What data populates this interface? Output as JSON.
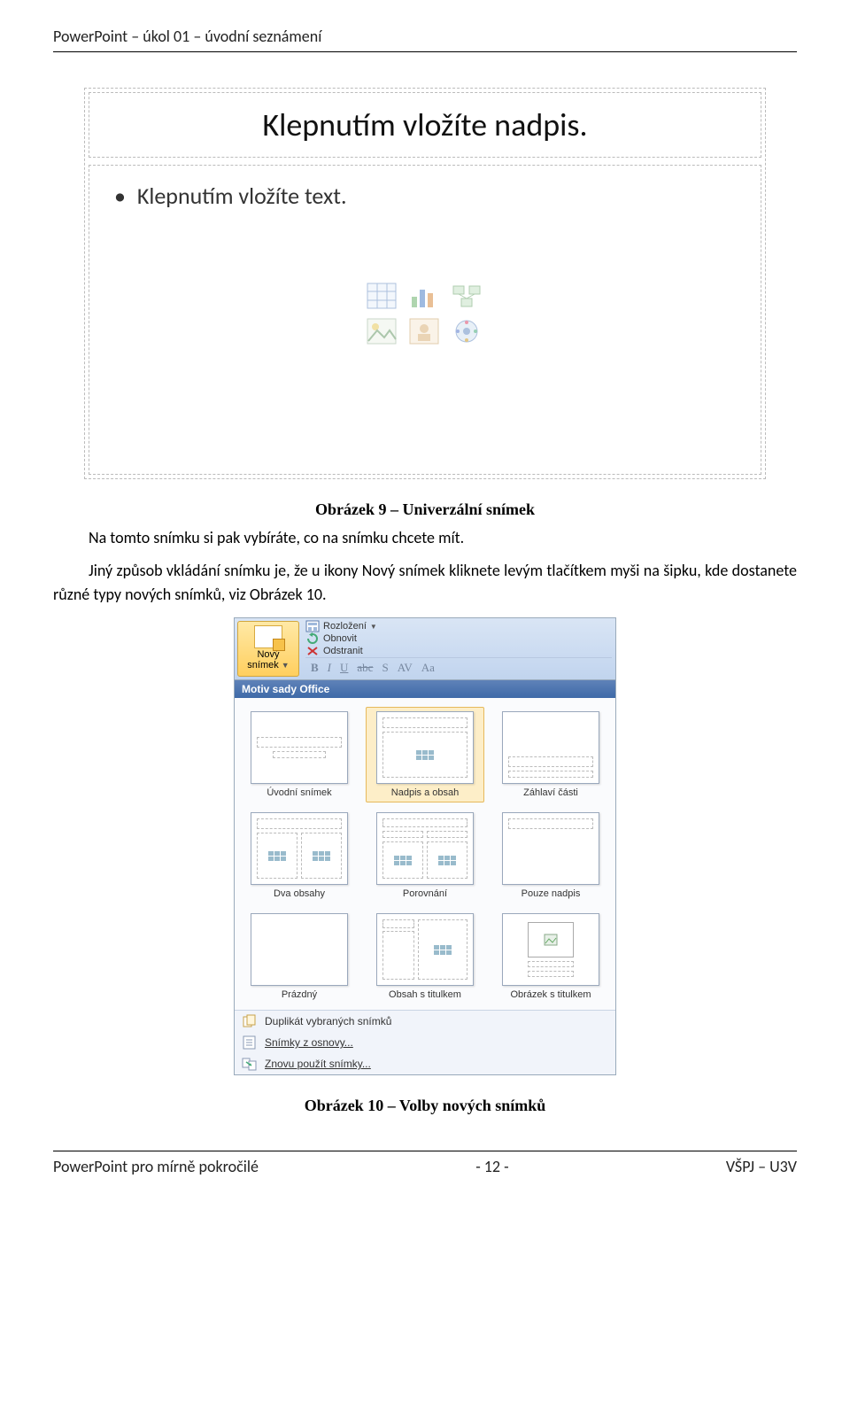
{
  "doc": {
    "header": "PowerPoint – úkol 01 – úvodní seznámení",
    "footer_left": "PowerPoint pro mírně pokročilé",
    "footer_center": "- 12 -",
    "footer_right": "VŠPJ – U3V"
  },
  "fig9": {
    "title_placeholder": "Klepnutím vložíte nadpis.",
    "body_placeholder": "Klepnutím vložíte text.",
    "caption": "Obrázek 9 – Univerzální snímek",
    "icons": {
      "table": "table-icon",
      "chart": "chart-icon",
      "smartart": "smartart-icon",
      "picture": "picture-icon",
      "clipart": "clipart-icon",
      "media": "media-icon"
    }
  },
  "para1": "Na tomto snímku si pak vybíráte, co na snímku chcete mít.",
  "para2": "Jiný způsob vkládání snímku je, že u ikony Nový snímek kliknete levým tlačítkem myši na šipku, kde dostanete různé typy nových snímků, viz Obrázek 10.",
  "fig10": {
    "new_slide_label_l1": "Nový",
    "new_slide_label_l2": "snímek",
    "ribbon_items": {
      "layout": "Rozložení",
      "reset": "Obnovit",
      "delete": "Odstranit"
    },
    "format_buttons": {
      "b": "B",
      "i": "I",
      "u": "U",
      "s": "abc",
      "shadow": "S",
      "spacing": "AV",
      "font": "Aa"
    },
    "gallery_header": "Motiv sady Office",
    "layouts": [
      "Úvodní snímek",
      "Nadpis a obsah",
      "Záhlaví části",
      "Dva obsahy",
      "Porovnání",
      "Pouze nadpis",
      "Prázdný",
      "Obsah s titulkem",
      "Obrázek s titulkem"
    ],
    "footer_items": [
      "Duplikát vybraných snímků",
      "Snímky z osnovy...",
      "Znovu použít snímky..."
    ],
    "caption": "Obrázek 10 – Volby nových snímků"
  }
}
